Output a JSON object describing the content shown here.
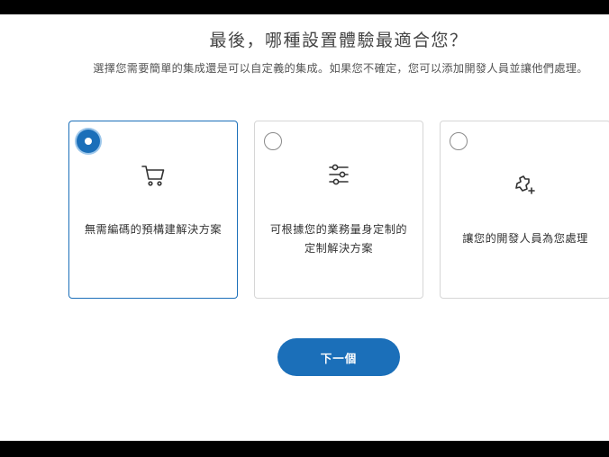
{
  "page": {
    "title": "最後，哪種設置體驗最適合您？",
    "subtitle": "選擇您需要簡單的集成還是可以自定義的集成。如果您不確定，您可以添加開發人員並讓他們處理。"
  },
  "options": [
    {
      "label": "無需編碼的預構建解決方案",
      "icon": "shopping-cart-icon",
      "selected": true
    },
    {
      "label": "可根據您的業務量身定制的定制解決方案",
      "icon": "sliders-icon",
      "selected": false
    },
    {
      "label": "讓您的開發人員為您處理",
      "icon": "puzzle-add-icon",
      "selected": false
    }
  ],
  "actions": {
    "next_label": "下一個"
  },
  "colors": {
    "accent": "#1b6fb9",
    "selected_ring": "#9cc6ea",
    "card_border": "#d6d6d6",
    "background": "#ffffff"
  }
}
